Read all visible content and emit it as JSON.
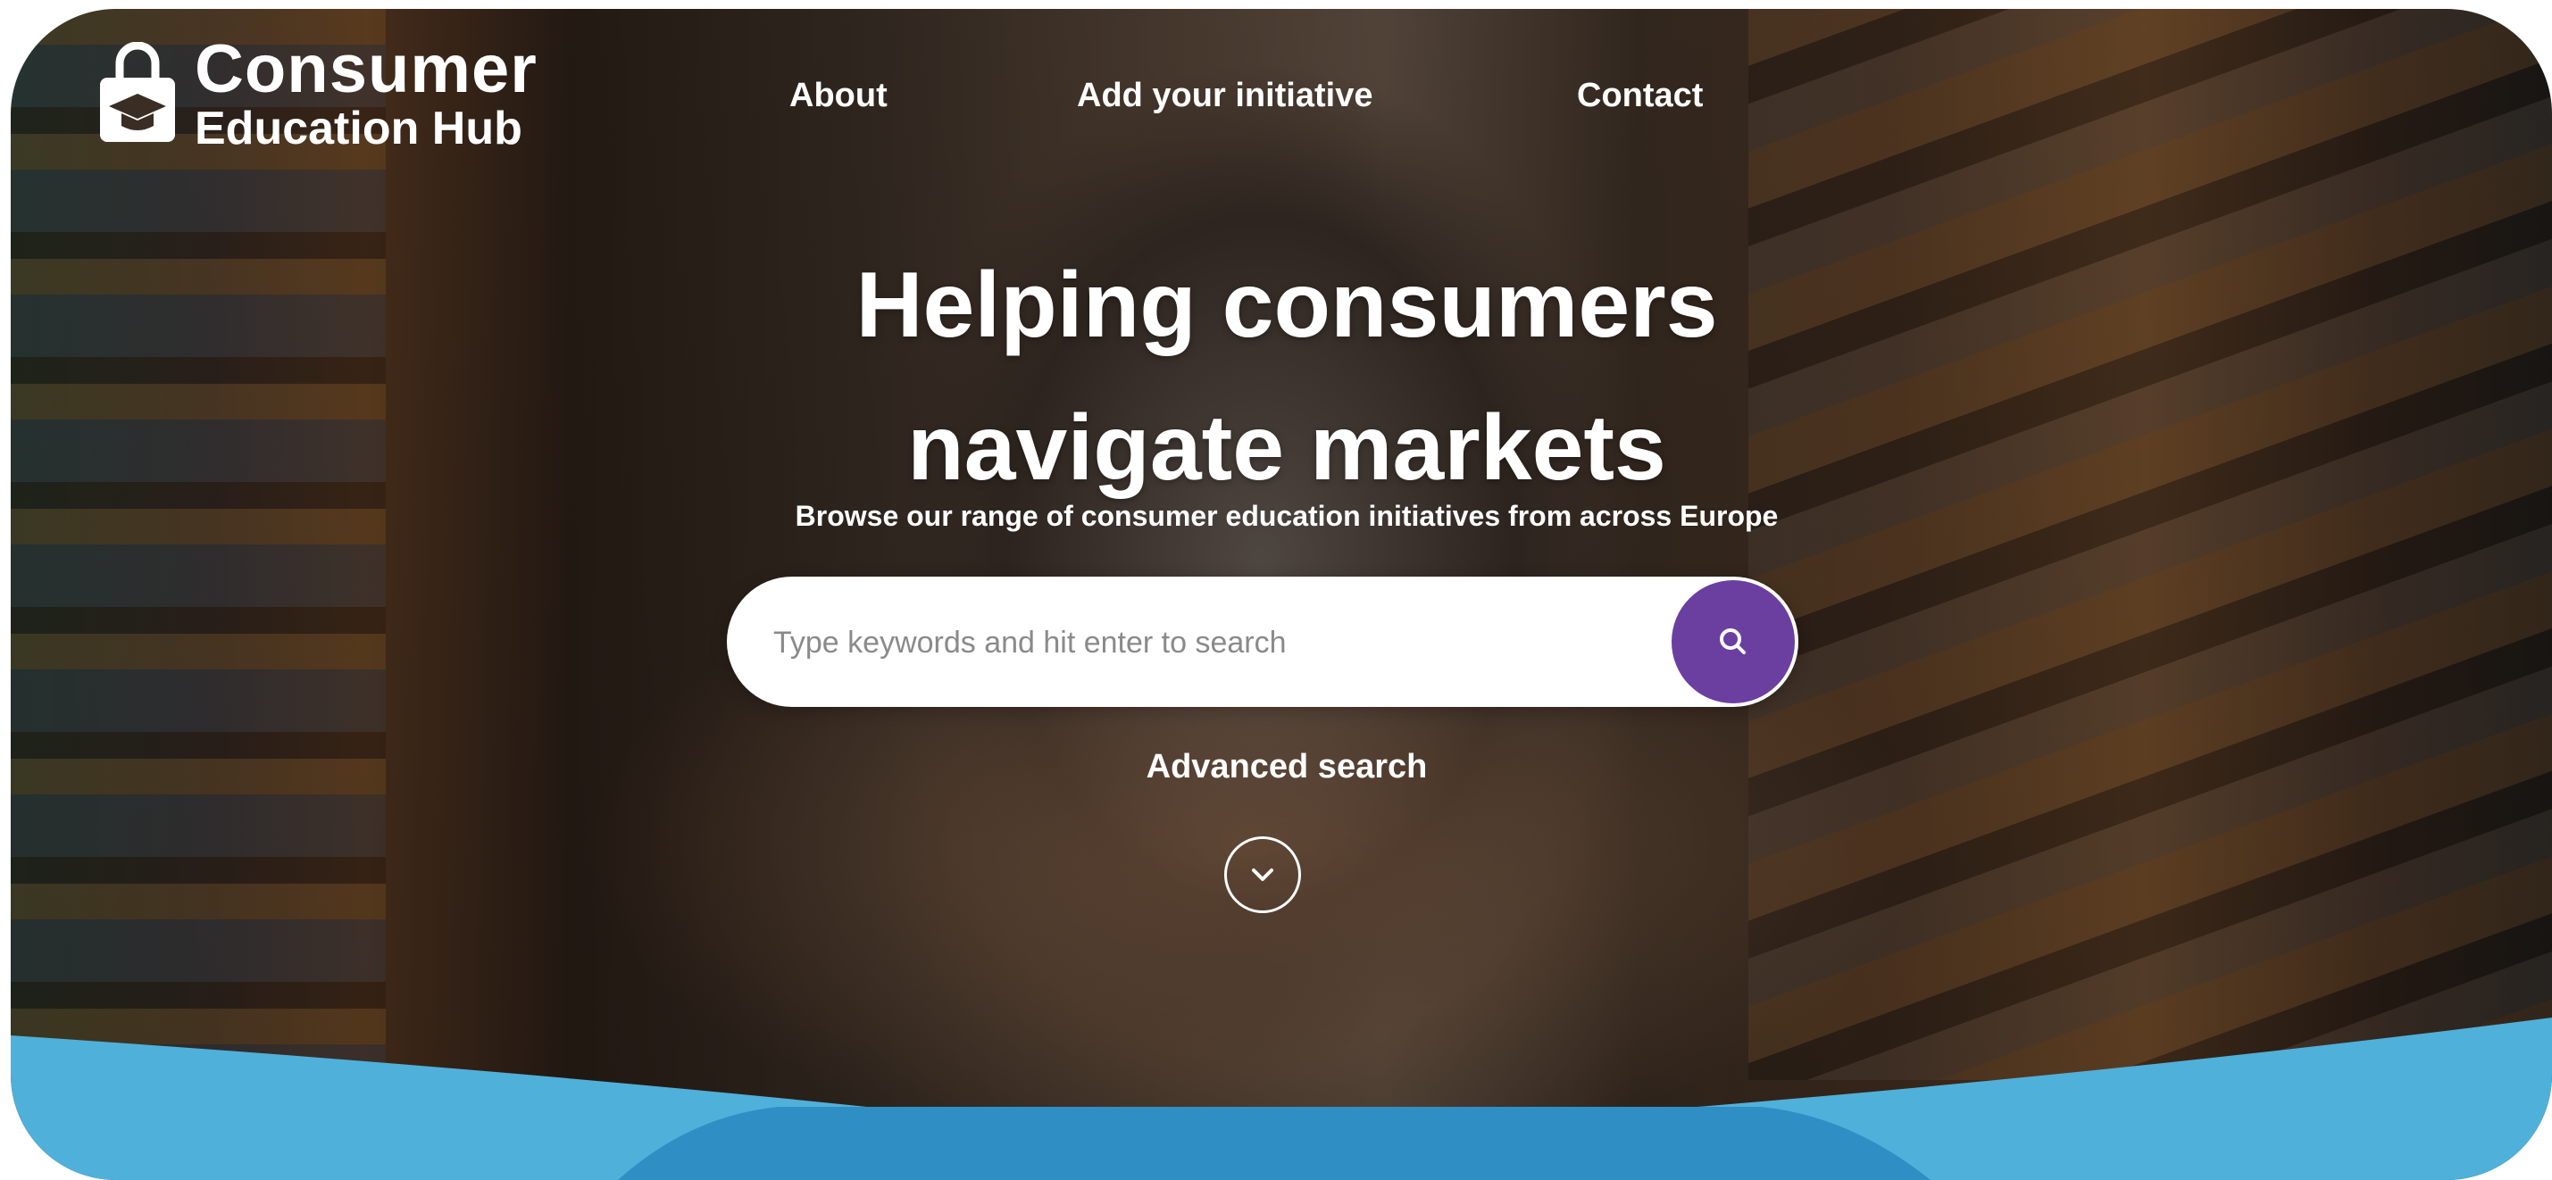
{
  "brand": {
    "line1": "Consumer",
    "line2": "Education Hub"
  },
  "nav": {
    "about": "About",
    "add_initiative": "Add your initiative",
    "contact": "Contact"
  },
  "hero": {
    "title_line1": "Helping consumers",
    "title_line2": "navigate markets",
    "subtitle": "Browse our range of consumer education initiatives from across Europe"
  },
  "search": {
    "placeholder": "Type keywords and hit enter to search"
  },
  "advanced_search": "Advanced search",
  "icons": {
    "logo": "shopping-bag-graduation-cap-icon",
    "search": "search-icon",
    "scroll": "chevron-down-icon"
  },
  "colors": {
    "accent": "#6b3fa0",
    "wave_light": "#4fb0da",
    "wave_dark": "#2f8fc4"
  }
}
